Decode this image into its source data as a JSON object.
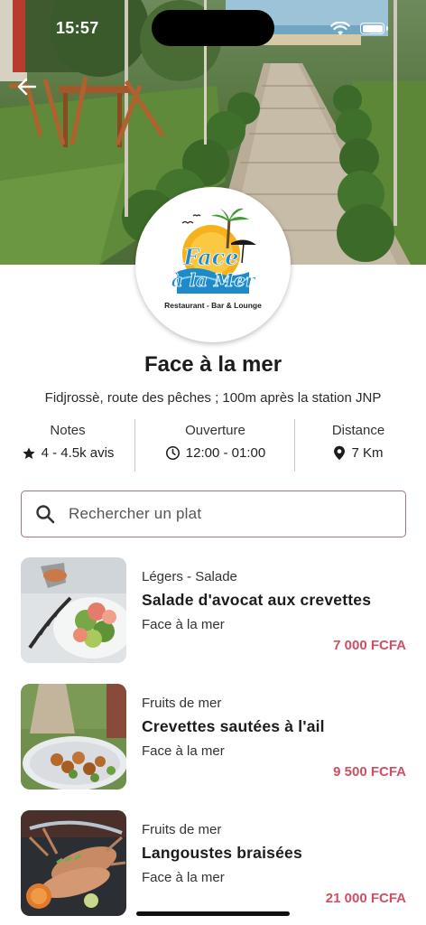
{
  "status_bar": {
    "time": "15:57"
  },
  "restaurant": {
    "name": "Face à la mer",
    "address": "Fidjrossè, route des pêches ; 100m après la station JNP",
    "logo": {
      "line1": "Face",
      "line2": "à la Mer",
      "tagline": "Restaurant - Bar & Lounge"
    }
  },
  "stats": {
    "rating": {
      "label": "Notes",
      "value": "4 - 4.5k avis",
      "icon": "star-icon"
    },
    "hours": {
      "label": "Ouverture",
      "value": "12:00 - 01:00",
      "icon": "clock-icon"
    },
    "distance": {
      "label": "Distance",
      "value": "7 Km",
      "icon": "location-pin-icon"
    }
  },
  "search": {
    "placeholder": "Rechercher un plat",
    "value": ""
  },
  "dishes": [
    {
      "category": "Légers - Salade",
      "name": "Salade d'avocat aux crevettes",
      "restaurant": "Face à la mer",
      "price": "7 000 FCFA"
    },
    {
      "category": "Fruits de mer",
      "name": "Crevettes sautées à l'ail",
      "restaurant": "Face à la mer",
      "price": "9 500 FCFA"
    },
    {
      "category": "Fruits de mer",
      "name": "Langoustes braisées",
      "restaurant": "Face à la mer",
      "price": "21 000 FCFA"
    }
  ],
  "colors": {
    "accent": "#d24e63",
    "search_border": "#a9737e",
    "text": "#1c1c1c"
  }
}
